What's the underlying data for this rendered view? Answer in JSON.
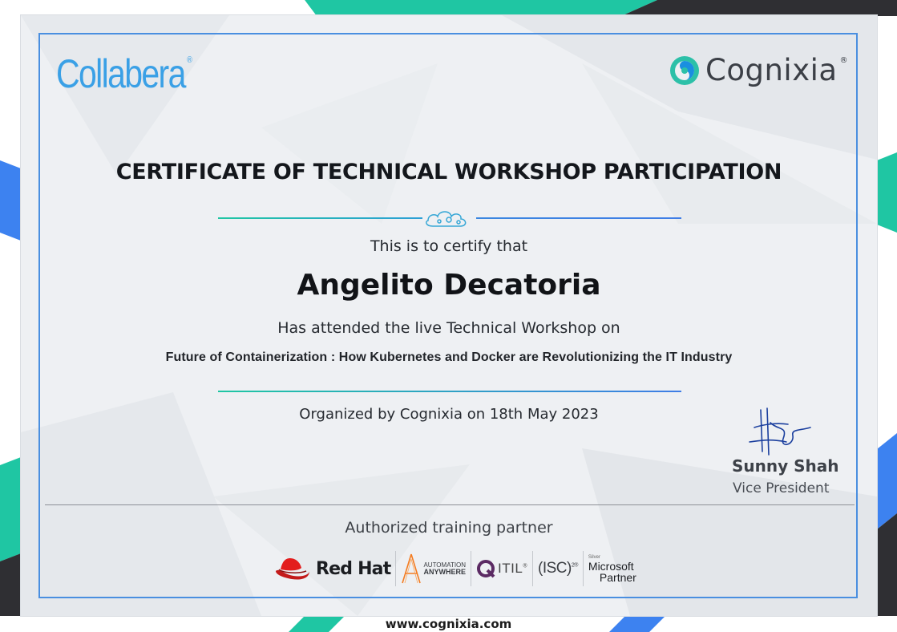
{
  "colors": {
    "accent_blue": "#4a8fe0",
    "accent_teal": "#1fc6a3",
    "dark_band": "#2f2f33",
    "collabera_blue": "#3aa0e6",
    "cognixia_teal": "#13b5a0"
  },
  "header": {
    "left_logo": {
      "text": "Collabera",
      "reg_mark": "®"
    },
    "right_logo": {
      "text": "Cognixia",
      "reg_mark": "®",
      "icon": "cognixia-swirl-icon"
    }
  },
  "certificate": {
    "title": "CERTIFICATE OF TECHNICAL WORKSHOP PARTICIPATION",
    "certify_line": "This is to certify that",
    "recipient_name": "Angelito Decatoria",
    "attended_line": "Has attended the live Technical Workshop on",
    "workshop_topic": "Future of Containerization : How Kubernetes and Docker are Revolutionizing the IT Industry",
    "organized_line": "Organized by Cognixia on 18th May 2023"
  },
  "signatory": {
    "name": "Sunny Shah",
    "role": "Vice President",
    "signature_icon": "signature-icon"
  },
  "partners": {
    "label": "Authorized training partner",
    "items": [
      {
        "name": "Red Hat",
        "icon": "redhat-hat-icon"
      },
      {
        "line1": "AUTOMATION",
        "line2": "ANYWHERE",
        "icon": "automation-anywhere-icon"
      },
      {
        "name": "ITIL",
        "reg_mark": "®",
        "icon": "itil-q-icon"
      },
      {
        "name": "(ISC)",
        "sup": "2®"
      },
      {
        "tier": "Silver",
        "line1": "Microsoft",
        "line2": "Partner"
      }
    ]
  },
  "footer": {
    "website": "www.cognixia.com"
  }
}
